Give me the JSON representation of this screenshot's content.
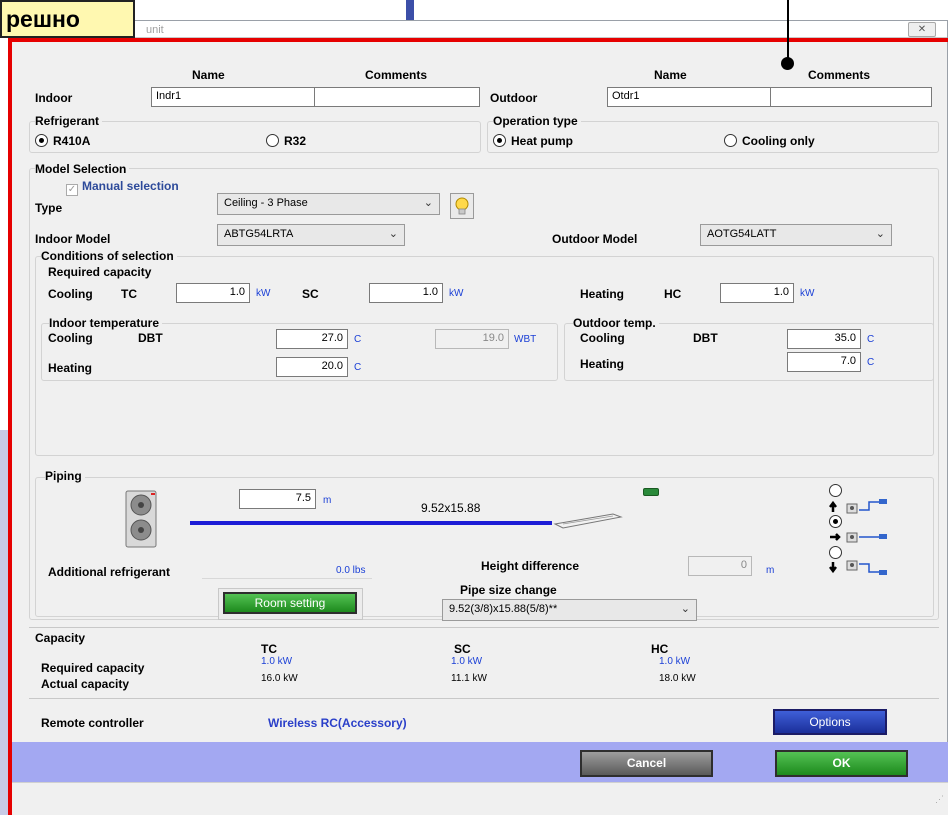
{
  "overlay_label": "решно",
  "window": {
    "title_fragment": "unit",
    "close_label": "✕"
  },
  "names": {
    "name_header": "Name",
    "comments_header": "Comments",
    "indoor_label": "Indoor",
    "indoor_name": "Indr1",
    "indoor_comment": "",
    "outdoor_label": "Outdoor",
    "outdoor_name": "Otdr1",
    "outdoor_comment": ""
  },
  "refrigerant": {
    "title": "Refrigerant",
    "options": [
      "R410A",
      "R32"
    ],
    "selected": "R410A"
  },
  "operation": {
    "title": "Operation type",
    "options": [
      "Heat pump",
      "Cooling only"
    ],
    "selected": "Heat pump"
  },
  "model": {
    "title": "Model Selection",
    "manual_label": "Manual selection",
    "manual_checked": true,
    "type_label": "Type",
    "type_value": "Ceiling - 3 Phase",
    "indoor_model_label": "Indoor Model",
    "indoor_model_value": "ABTG54LRTA",
    "outdoor_model_label": "Outdoor Model",
    "outdoor_model_value": "AOTG54LATT"
  },
  "conditions": {
    "title": "Conditions of selection",
    "required_title": "Required capacity",
    "cooling_label": "Cooling",
    "tc_label": "TC",
    "tc_value": "1.0",
    "sc_label": "SC",
    "sc_value": "1.0",
    "heating_label": "Heating",
    "hc_label": "HC",
    "hc_value": "1.0",
    "unit_kw": "kW",
    "indoor_temp_title": "Indoor temperature",
    "dbt_label": "DBT",
    "indoor_cool_dbt": "27.0",
    "indoor_wbt": "19.0",
    "wbt_unit": "WBT",
    "indoor_heat_dbt": "20.0",
    "unit_c": "C",
    "outdoor_temp_title": "Outdoor temp.",
    "outdoor_cool_dbt": "35.0",
    "outdoor_heat_dbt": "7.0"
  },
  "piping": {
    "title": "Piping",
    "length_value": "7.5",
    "length_unit": "m",
    "pipe_size": "9.52x15.88",
    "additional_ref_label": "Additional refrigerant",
    "additional_ref_value": "0.0 lbs",
    "height_diff_label": "Height difference",
    "height_diff_value": "0",
    "height_diff_unit": "m",
    "pipe_size_change_label": "Pipe size change",
    "pipe_size_change_value": "9.52(3/8)x15.88(5/8)**",
    "room_setting_label": "Room setting",
    "layout_selected_index": 1
  },
  "capacity": {
    "title": "Capacity",
    "headers": [
      "TC",
      "SC",
      "HC"
    ],
    "required_label": "Required capacity",
    "required_values": [
      "1.0 kW",
      "1.0 kW",
      "1.0 kW"
    ],
    "actual_label": "Actual capacity",
    "actual_values": [
      "16.0 kW",
      "11.1 kW",
      "18.0 kW"
    ]
  },
  "remote": {
    "label": "Remote controller",
    "value": "Wireless RC(Accessory)",
    "options_label": "Options"
  },
  "footer": {
    "cancel_label": "Cancel",
    "ok_label": "OK"
  },
  "colors": {
    "accent_red": "#e60000",
    "footer_band": "#a3a8f2",
    "callout_bg": "#fff8b0"
  }
}
